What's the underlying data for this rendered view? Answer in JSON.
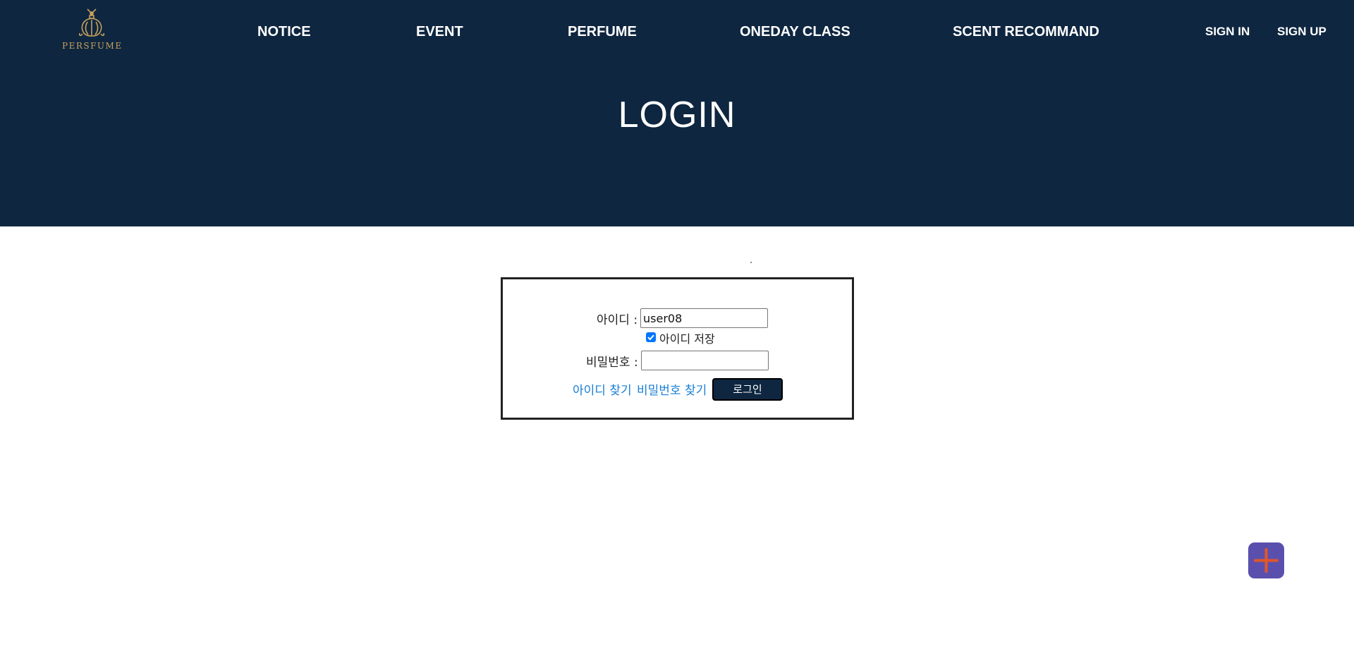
{
  "brand": {
    "name": "PERSFUME",
    "logo_icon": "perfume-bottle-icon",
    "accent_color": "#c9a25c"
  },
  "colors": {
    "header_bg": "#0e2640",
    "link": "#1a7fd4",
    "fab_bg": "#5b4fae",
    "fab_icon": "#e0572a"
  },
  "nav": {
    "items": [
      {
        "label": "NOTICE"
      },
      {
        "label": "EVENT"
      },
      {
        "label": "PERFUME"
      },
      {
        "label": "ONEDAY CLASS"
      },
      {
        "label": "SCENT RECOMMAND"
      }
    ]
  },
  "auth": {
    "sign_in": "SIGN IN",
    "sign_up": "SIGN UP"
  },
  "page": {
    "title": "LOGIN"
  },
  "login_form": {
    "id_label": "아이디 :",
    "id_value": "user08",
    "remember_label": "아이디 저장",
    "remember_checked": true,
    "password_label": "비밀번호 :",
    "password_value": "",
    "find_id": "아이디 찾기",
    "find_password": "비밀번호 찾기",
    "submit": "로그인"
  },
  "fab": {
    "icon": "plus-icon"
  }
}
